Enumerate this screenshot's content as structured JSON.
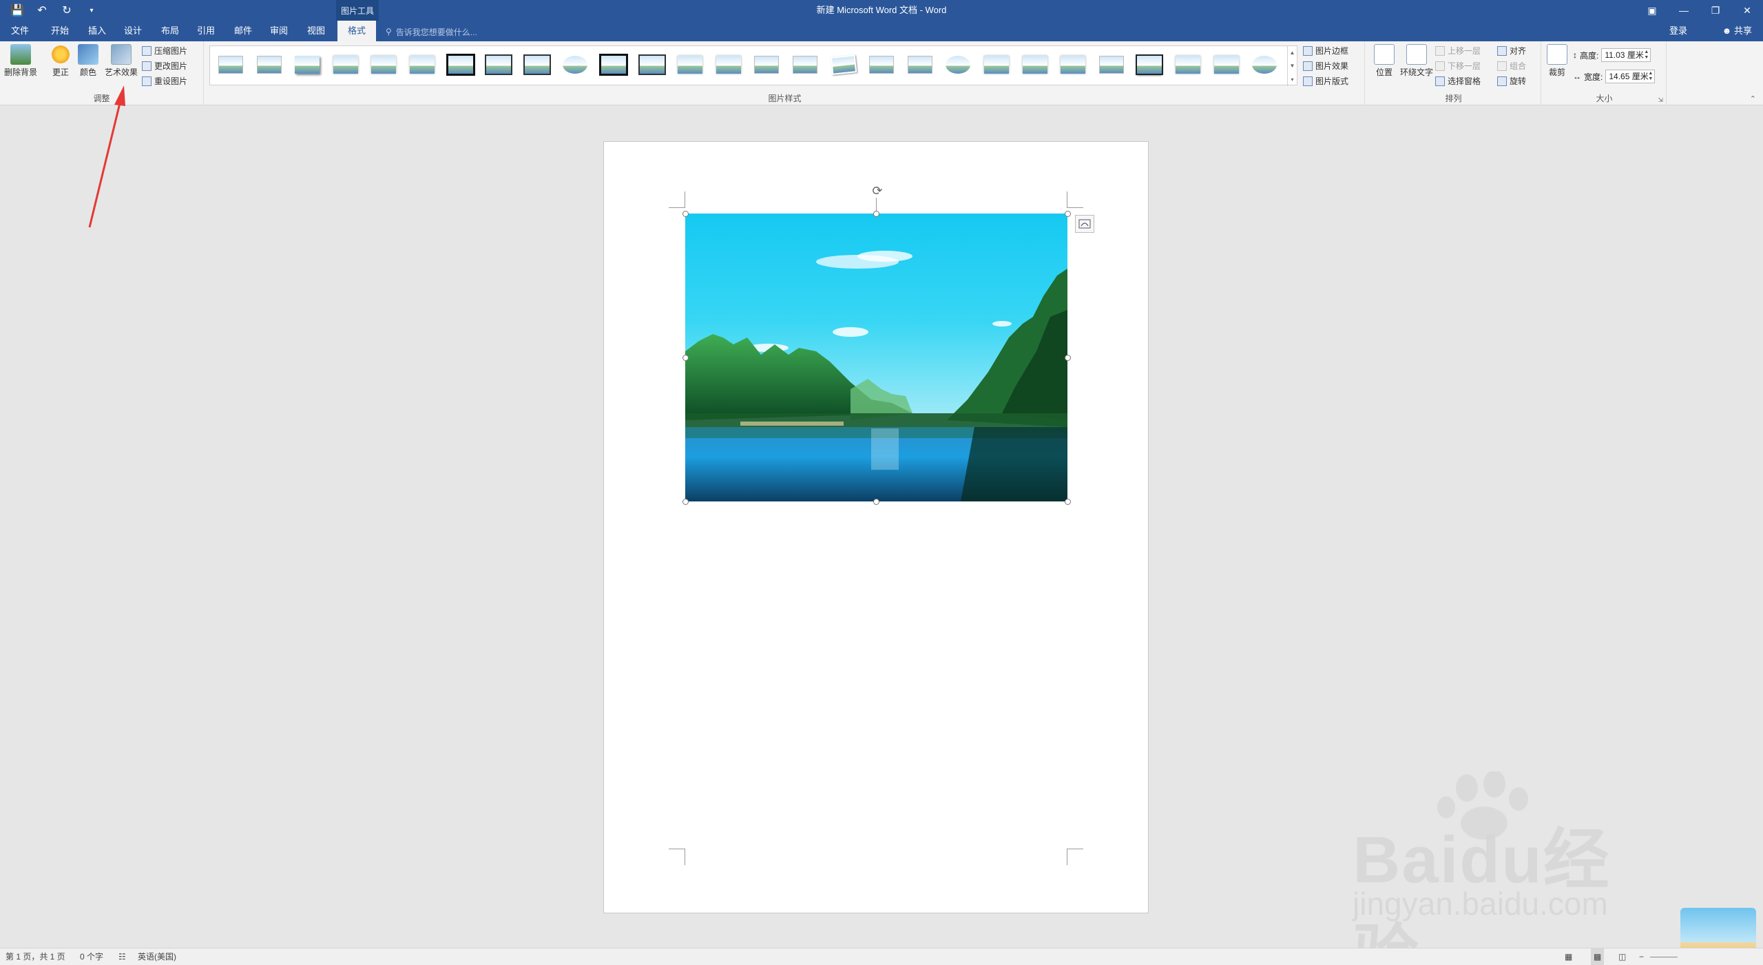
{
  "titlebar": {
    "document_title": "新建 Microsoft Word 文档 - Word",
    "context_tools": "图片工具",
    "quick_access": [
      "save-icon",
      "undo-icon",
      "redo-icon",
      "customize-icon"
    ],
    "window_controls": [
      "ribbon-display-icon",
      "minimize-icon",
      "restore-icon",
      "close-icon"
    ]
  },
  "tabs": [
    {
      "label": "文件"
    },
    {
      "label": "开始"
    },
    {
      "label": "插入"
    },
    {
      "label": "设计"
    },
    {
      "label": "布局"
    },
    {
      "label": "引用"
    },
    {
      "label": "邮件"
    },
    {
      "label": "审阅"
    },
    {
      "label": "视图"
    },
    {
      "label": "格式",
      "active": true
    }
  ],
  "tell_me": "告诉我您想要做什么...",
  "account": {
    "login": "登录",
    "share": "共享"
  },
  "ribbon": {
    "adjust": {
      "group_label": "调整",
      "remove_bg": "删除背景",
      "corrections": "更正",
      "color": "颜色",
      "artistic": "艺术效果",
      "compress": "压缩图片",
      "change": "更改图片",
      "reset": "重设图片"
    },
    "styles": {
      "group_label": "图片样式",
      "border": "图片边框",
      "effects": "图片效果",
      "layout": "图片版式"
    },
    "arrange": {
      "group_label": "排列",
      "position": "位置",
      "wrap": "环绕文字",
      "forward": "上移一层",
      "backward": "下移一层",
      "pane": "选择窗格",
      "align": "对齐",
      "group": "组合",
      "rotate": "旋转"
    },
    "size": {
      "group_label": "大小",
      "crop": "裁剪",
      "height_label": "高度:",
      "height_value": "11.03 厘米",
      "width_label": "宽度:",
      "width_value": "14.65 厘米"
    }
  },
  "status": {
    "page": "第 1 页，共 1 页",
    "words": "0 个字",
    "language": "英语(美国)",
    "zoom_minus": "−"
  },
  "watermark": {
    "brand": "Baidu经验",
    "url": "jingyan.baidu.com"
  },
  "colors": {
    "word_blue": "#2b579a",
    "ribbon_bg": "#f3f3f3",
    "arrow_red": "#e53935"
  }
}
